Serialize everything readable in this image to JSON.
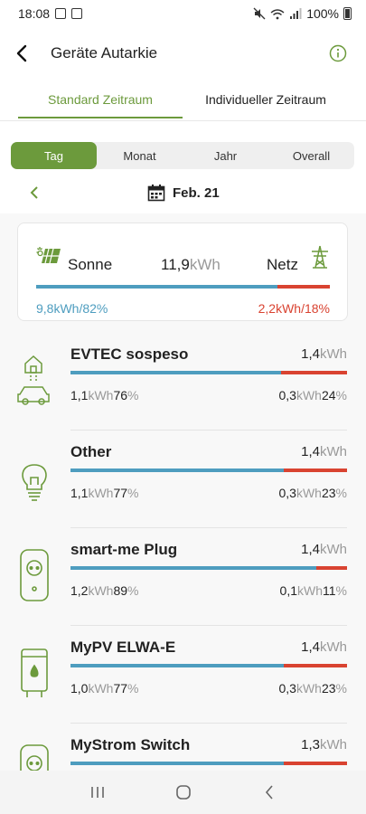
{
  "status_bar": {
    "time": "18:08",
    "battery": "100%"
  },
  "header": {
    "title": "Geräte Autarkie"
  },
  "tabs": [
    {
      "label": "Standard Zeitraum",
      "active": true
    },
    {
      "label": "Individueller Zeitraum",
      "active": false
    }
  ],
  "periods": [
    {
      "label": "Tag",
      "active": true
    },
    {
      "label": "Monat",
      "active": false
    },
    {
      "label": "Jahr",
      "active": false
    },
    {
      "label": "Overall",
      "active": false
    }
  ],
  "date_nav": {
    "label": "Feb. 21"
  },
  "summary": {
    "sun_label": "Sonne",
    "grid_label": "Netz",
    "total_value": "11,9",
    "unit": "kWh",
    "sun_value": "9,8",
    "sun_percent": "82%",
    "grid_value": "2,2",
    "grid_percent": "18%",
    "sun_fraction": 0.82
  },
  "devices": [
    {
      "icon": "house-car-icon",
      "name": "EVTEC sospeso",
      "total": "1,4",
      "unit": "kWh",
      "sun_value": "1,1",
      "sun_percent": "76",
      "grid_value": "0,3",
      "grid_percent": "24",
      "percent_sign": "%",
      "sun_fraction": 0.76
    },
    {
      "icon": "light-bulb-icon",
      "name": "Other",
      "total": "1,4",
      "unit": "kWh",
      "sun_value": "1,1",
      "sun_percent": "77",
      "grid_value": "0,3",
      "grid_percent": "23",
      "percent_sign": "%",
      "sun_fraction": 0.77
    },
    {
      "icon": "smart-plug-icon",
      "name": "smart-me Plug",
      "total": "1,4",
      "unit": "kWh",
      "sun_value": "1,2",
      "sun_percent": "89",
      "grid_value": "0,1",
      "grid_percent": "11",
      "percent_sign": "%",
      "sun_fraction": 0.89
    },
    {
      "icon": "water-heater-icon",
      "name": "MyPV ELWA-E",
      "total": "1,4",
      "unit": "kWh",
      "sun_value": "1,0",
      "sun_percent": "77",
      "grid_value": "0,3",
      "grid_percent": "23",
      "percent_sign": "%",
      "sun_fraction": 0.77
    },
    {
      "icon": "smart-plug-icon",
      "name": "MyStrom Switch",
      "total": "1,3",
      "unit": "kWh",
      "sun_value": "",
      "sun_percent": "",
      "grid_value": "",
      "grid_percent": "",
      "percent_sign": "",
      "sun_fraction": 0.77
    }
  ],
  "colors": {
    "accent": "#6c9a3c",
    "sun": "#4e9dbf",
    "grid": "#d94331"
  }
}
